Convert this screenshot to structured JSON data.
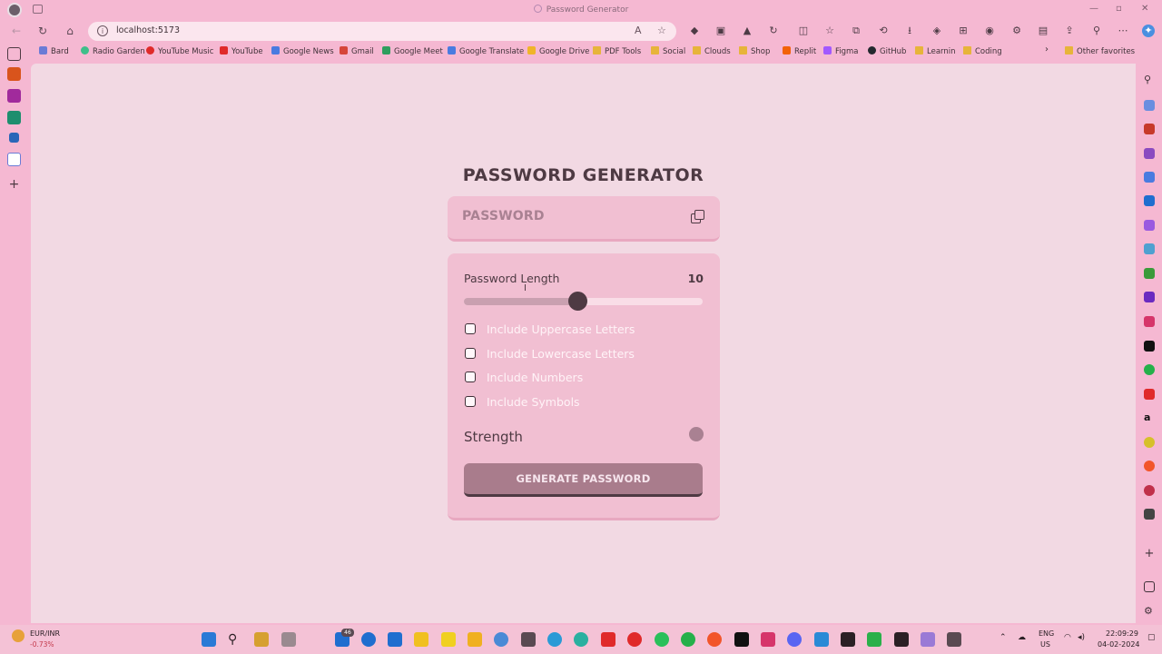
{
  "window": {
    "title": "Password Generator"
  },
  "browser": {
    "url": "localhost:5173",
    "bookmarks": [
      {
        "label": "Bard",
        "color": "#6b7bd6"
      },
      {
        "label": "Radio Garden",
        "color": "#3fbf8a"
      },
      {
        "label": "YouTube Music",
        "color": "#e02a2a"
      },
      {
        "label": "YouTube",
        "color": "#e02a2a"
      },
      {
        "label": "Google News",
        "color": "#4a7be0"
      },
      {
        "label": "Gmail",
        "color": "#d6453a"
      },
      {
        "label": "Google Meet",
        "color": "#2f9e5e"
      },
      {
        "label": "Google Translate",
        "color": "#4a7be0"
      },
      {
        "label": "Google Drive",
        "color": "#f0b429"
      },
      {
        "label": "PDF Tools",
        "color": "folder"
      },
      {
        "label": "Social",
        "color": "folder"
      },
      {
        "label": "Clouds",
        "color": "folder"
      },
      {
        "label": "Shop",
        "color": "folder"
      },
      {
        "label": "Replit",
        "color": "#f26207"
      },
      {
        "label": "Figma",
        "color": "#a259ff"
      },
      {
        "label": "GitHub",
        "color": "#24292f"
      },
      {
        "label": "Learnin",
        "color": "folder"
      },
      {
        "label": "Coding",
        "color": "folder"
      }
    ],
    "other_favorites": "Other favorites"
  },
  "app": {
    "title": "PASSWORD GENERATOR",
    "password_placeholder": "PASSWORD",
    "length_label": "Password Length",
    "length_value": "10",
    "length_fraction": 0.475,
    "options": [
      {
        "label": "Include Uppercase Letters",
        "checked": false
      },
      {
        "label": "Include Lowercase Letters",
        "checked": false
      },
      {
        "label": "Include Numbers",
        "checked": false
      },
      {
        "label": "Include Symbols",
        "checked": false
      }
    ],
    "strength_label": "Strength",
    "strength_color": "#a98192",
    "generate_label": "GENERATE PASSWORD"
  },
  "taskbar": {
    "ticker_name": "EUR/INR",
    "ticker_change": "-0.73%",
    "lang_top": "ENG",
    "lang_bottom": "US",
    "time": "22:09:29",
    "date": "04-02-2024",
    "badge_edge": "46"
  }
}
